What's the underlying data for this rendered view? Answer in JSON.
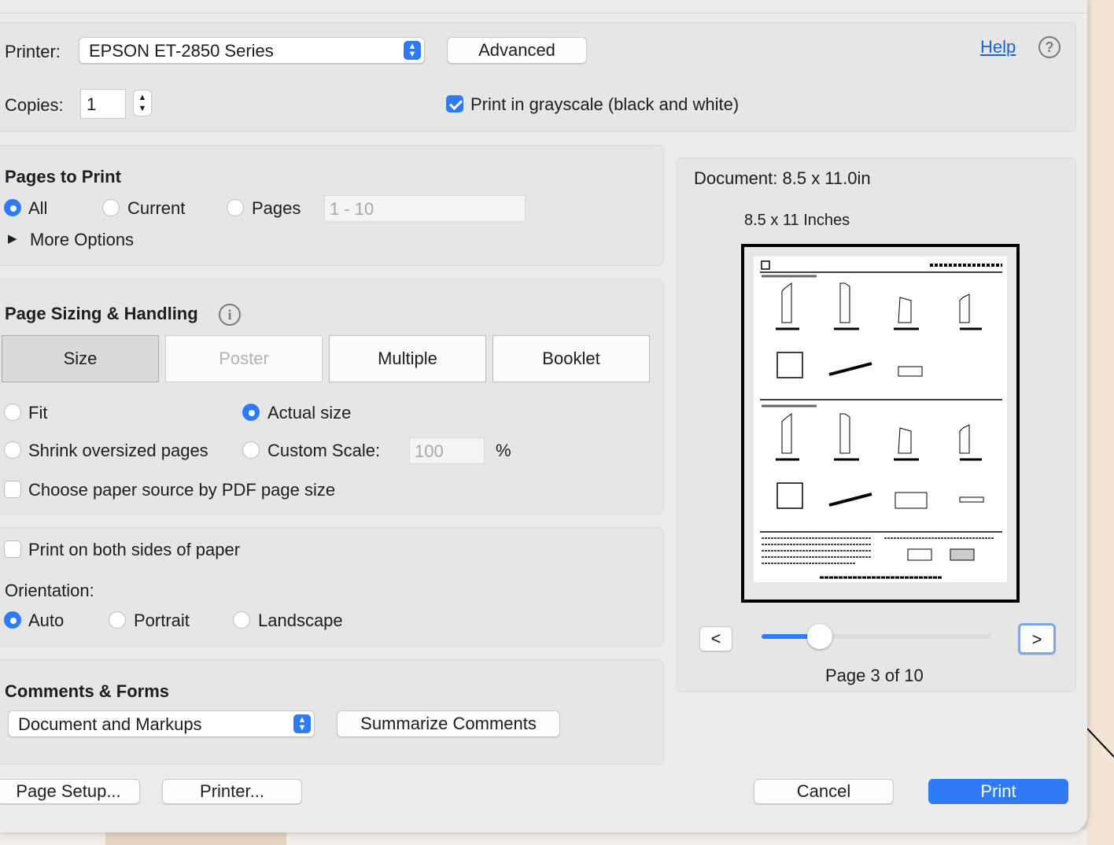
{
  "printer": {
    "label": "Printer:",
    "selected": "EPSON ET-2850 Series",
    "advanced_label": "Advanced",
    "help_label": "Help",
    "help_icon": "question-circle-icon"
  },
  "copies": {
    "label": "Copies:",
    "value": "1"
  },
  "grayscale": {
    "label": "Print in grayscale (black and white)",
    "checked": true
  },
  "pages_to_print": {
    "title": "Pages to Print",
    "all_label": "All",
    "current_label": "Current",
    "pages_label": "Pages",
    "pages_placeholder": "1 - 10",
    "selected": "All",
    "more_options_label": "More Options"
  },
  "sizing": {
    "title": "Page Sizing & Handling",
    "tabs": [
      "Size",
      "Poster",
      "Multiple",
      "Booklet"
    ],
    "selected_tab": "Size",
    "disabled_tab": "Poster",
    "fit_label": "Fit",
    "actual_size_label": "Actual size",
    "shrink_label": "Shrink oversized pages",
    "custom_scale_label": "Custom Scale:",
    "custom_scale_value": "100",
    "percent_label": "%",
    "selected_option": "Actual size",
    "paper_source_label": "Choose paper source by PDF page size",
    "paper_source_checked": false
  },
  "duplex": {
    "label": "Print on both sides of paper",
    "checked": false,
    "orientation_label": "Orientation:",
    "auto_label": "Auto",
    "portrait_label": "Portrait",
    "landscape_label": "Landscape",
    "selected_orientation": "Auto"
  },
  "comments": {
    "title": "Comments & Forms",
    "selected": "Document and Markups",
    "summarize_label": "Summarize Comments"
  },
  "preview": {
    "document_size": "Document: 8.5 x 11.0in",
    "paper_label": "8.5 x 11 Inches",
    "prev_label": "<",
    "next_label": ">",
    "page_indicator": "Page 3 of 10",
    "current_page": 3,
    "total_pages": 10
  },
  "footer": {
    "page_setup_label": "Page Setup...",
    "printer_label": "Printer...",
    "cancel_label": "Cancel",
    "print_label": "Print"
  },
  "colors": {
    "accent": "#2f7bf5",
    "link": "#1a63d2",
    "dialog_bg": "#ececec"
  }
}
